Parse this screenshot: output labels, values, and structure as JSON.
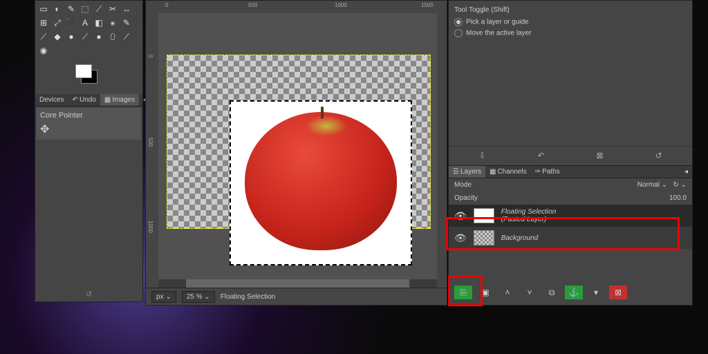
{
  "toolbox": {
    "tools": [
      "▭",
      "◐",
      "✎",
      "⬚",
      "⟋",
      "✂",
      "↔",
      "⊞",
      "⤢",
      "⬛",
      "A",
      "◧",
      "⚹",
      "✎",
      "⟋",
      "◆",
      "●",
      "⟋",
      "●",
      "⬯",
      "⟋",
      "◉"
    ],
    "tabs": {
      "devices": "Devices",
      "undo": "Undo",
      "images": "Images"
    },
    "core_pointer": "Core Pointer"
  },
  "canvas": {
    "ruler_marks": [
      "0",
      "500",
      "1000",
      "1500"
    ],
    "ruler_v": [
      "0",
      "500",
      "1000"
    ],
    "unit": "px",
    "zoom": "25 %",
    "status": "Floating Selection"
  },
  "tool_options": {
    "title": "Tool Toggle  (Shift)",
    "opt1": "Pick a layer or guide",
    "opt2": "Move the active layer"
  },
  "layers_panel": {
    "tabs": {
      "layers": "Layers",
      "channels": "Channels",
      "paths": "Paths"
    },
    "mode_label": "Mode",
    "mode_value": "Normal",
    "opacity_label": "Opacity",
    "opacity_value": "100.0",
    "layers": [
      {
        "name": "Floating Selection",
        "sub": "(Pasted Layer)"
      },
      {
        "name": "Background",
        "sub": ""
      }
    ]
  }
}
